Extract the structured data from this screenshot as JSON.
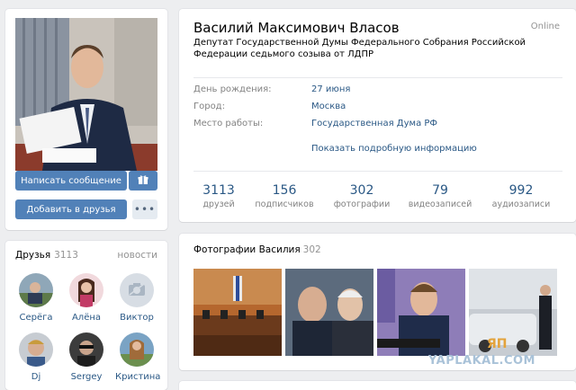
{
  "profile": {
    "name": "Василий Максимович Власов",
    "online": "Online",
    "status": "Депутат Государственной Думы Федерального Собрания Российской Федерации седьмого созыва от ЛДПР"
  },
  "actions": {
    "message": "Написать сообщение",
    "add_friend": "Добавить в друзья",
    "more": "•••"
  },
  "info": {
    "rows": [
      {
        "label": "День рождения:",
        "value": "27 июня"
      },
      {
        "label": "Город:",
        "value": "Москва"
      },
      {
        "label": "Место работы:",
        "value": "Государственная Дума РФ"
      }
    ],
    "details_link": "Показать подробную информацию"
  },
  "counters": [
    {
      "value": "3113",
      "label": "друзей"
    },
    {
      "value": "156",
      "label": "подписчиков"
    },
    {
      "value": "302",
      "label": "фотографии"
    },
    {
      "value": "79",
      "label": "видеозаписей"
    },
    {
      "value": "992",
      "label": "аудиозаписи"
    }
  ],
  "friends": {
    "title": "Друзья",
    "count": "3113",
    "news_link": "новости",
    "items": [
      {
        "name": "Серёга"
      },
      {
        "name": "Алёна"
      },
      {
        "name": "Виктор"
      },
      {
        "name": "Dj"
      },
      {
        "name": "Sergey"
      },
      {
        "name": "Кристина"
      }
    ]
  },
  "photos": {
    "title": "Фотографии Василия",
    "count": "302"
  },
  "watermark": {
    "text": "YAPLAKAL.COM",
    "mark": "ЯП"
  },
  "colors": {
    "accent": "#5181b8",
    "link": "#2a5885",
    "background": "#edeef0"
  },
  "icons": [
    "gift-icon",
    "camera-icon"
  ]
}
